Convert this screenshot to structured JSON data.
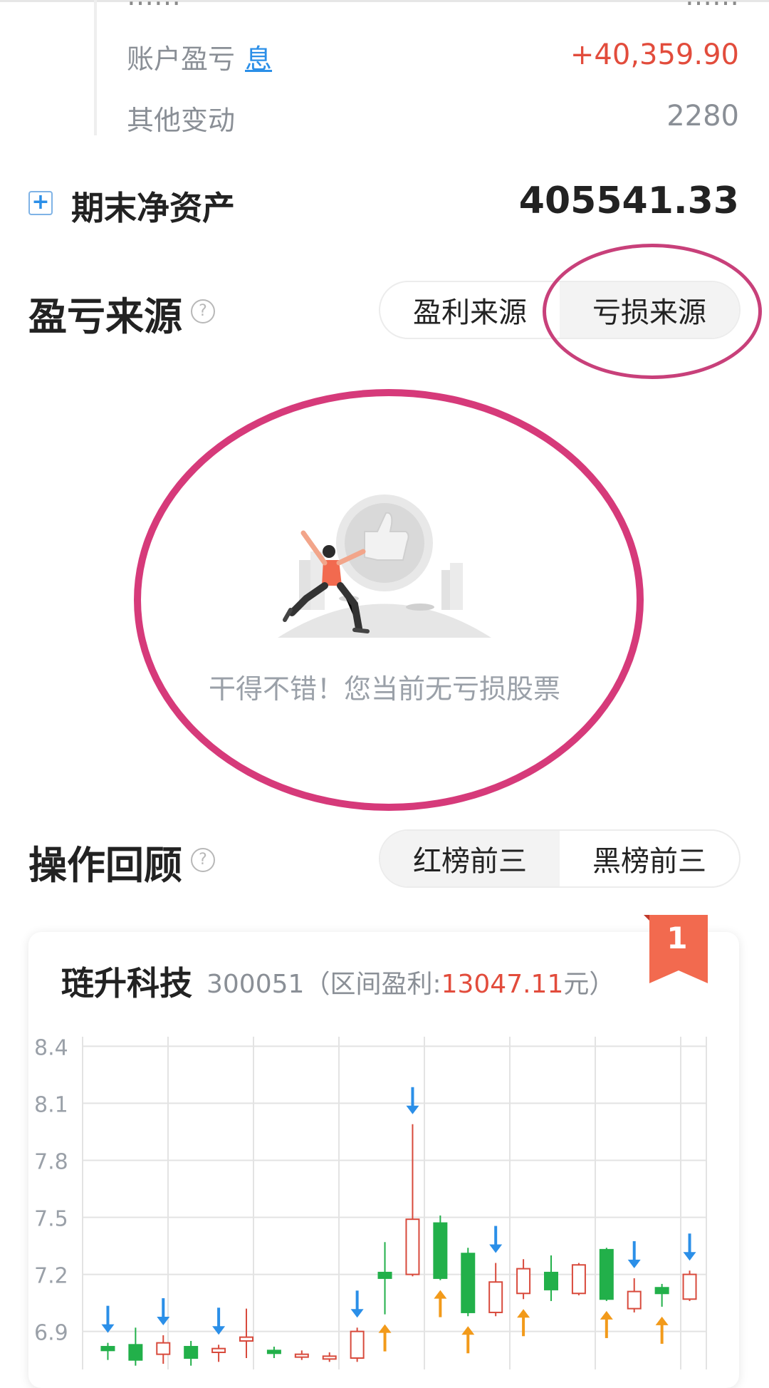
{
  "summary": {
    "cutoff_label": "……",
    "cutoff_value": "……",
    "rows": [
      {
        "label": "账户盈亏",
        "link": "息",
        "value": "+40,359.90"
      },
      {
        "label": "其他变动",
        "value": "2280"
      }
    ],
    "net_label": "期末净资产",
    "net_value": "405541.33"
  },
  "pnl_source": {
    "title": "盈亏来源",
    "tabs": [
      {
        "label": "盈利来源",
        "active": false
      },
      {
        "label": "亏损来源",
        "active": true
      }
    ],
    "empty_message": "干得不错！您当前无亏损股票"
  },
  "review": {
    "title": "操作回顾",
    "tabs": [
      {
        "label": "红榜前三",
        "active": true
      },
      {
        "label": "黑榜前三",
        "active": false
      }
    ]
  },
  "stock_card": {
    "rank": "1",
    "name": "琏升科技",
    "code": "300051",
    "prefix": "（区间盈利:",
    "profit": "13047.11",
    "suffix": "元）"
  },
  "colors": {
    "up": "#d84a3c",
    "down": "#22b04a",
    "buy_arrow": "#f29a1a",
    "sell_arrow": "#2b8fe8",
    "annotation": "#d63a7a",
    "ribbon": "#f26a4f"
  },
  "chart_data": {
    "type": "candlestick",
    "y_ticks": [
      "8.4",
      "8.1",
      "7.8",
      "7.5",
      "7.2",
      "6.9"
    ],
    "ylim": [
      6.7,
      8.45
    ],
    "candles": [
      {
        "o": 6.82,
        "c": 6.8,
        "h": 6.84,
        "l": 6.75
      },
      {
        "o": 6.83,
        "c": 6.75,
        "h": 6.92,
        "l": 6.72
      },
      {
        "o": 6.78,
        "c": 6.84,
        "h": 6.88,
        "l": 6.73
      },
      {
        "o": 6.82,
        "c": 6.76,
        "h": 6.85,
        "l": 6.72
      },
      {
        "o": 6.79,
        "c": 6.81,
        "h": 6.83,
        "l": 6.74
      },
      {
        "o": 6.85,
        "c": 6.87,
        "h": 7.02,
        "l": 6.76
      },
      {
        "o": 6.8,
        "c": 6.79,
        "h": 6.82,
        "l": 6.76
      },
      {
        "o": 6.77,
        "c": 6.78,
        "h": 6.8,
        "l": 6.75
      },
      {
        "o": 6.76,
        "c": 6.77,
        "h": 6.79,
        "l": 6.74
      },
      {
        "o": 6.76,
        "c": 6.9,
        "h": 6.92,
        "l": 6.74
      },
      {
        "o": 7.21,
        "c": 7.18,
        "h": 7.37,
        "l": 6.99
      },
      {
        "o": 7.2,
        "c": 7.49,
        "h": 7.99,
        "l": 7.19
      },
      {
        "o": 7.47,
        "c": 7.18,
        "h": 7.51,
        "l": 7.17
      },
      {
        "o": 7.31,
        "c": 7.0,
        "h": 7.34,
        "l": 6.98
      },
      {
        "o": 7.0,
        "c": 7.16,
        "h": 7.26,
        "l": 6.98
      },
      {
        "o": 7.1,
        "c": 7.23,
        "h": 7.28,
        "l": 7.07
      },
      {
        "o": 7.21,
        "c": 7.12,
        "h": 7.3,
        "l": 7.06
      },
      {
        "o": 7.1,
        "c": 7.25,
        "h": 7.26,
        "l": 7.09
      },
      {
        "o": 7.33,
        "c": 7.07,
        "h": 7.34,
        "l": 7.06
      },
      {
        "o": 7.02,
        "c": 7.11,
        "h": 7.18,
        "l": 7.0
      },
      {
        "o": 7.13,
        "c": 7.1,
        "h": 7.15,
        "l": 7.03
      },
      {
        "o": 7.07,
        "c": 7.2,
        "h": 7.22,
        "l": 7.06
      }
    ],
    "sell_markers": [
      0,
      2,
      4,
      9,
      11,
      14,
      19,
      21
    ],
    "buy_markers": [
      10,
      12,
      13,
      15,
      18,
      20
    ]
  }
}
